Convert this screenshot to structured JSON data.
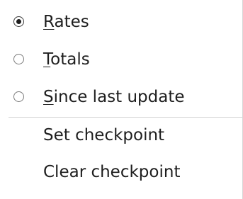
{
  "menu": {
    "radio_items": [
      {
        "mnemonic": "R",
        "rest": "ates",
        "selected": true
      },
      {
        "mnemonic": "T",
        "rest": "otals",
        "selected": false
      },
      {
        "mnemonic": "S",
        "rest": "ince last update",
        "selected": false
      }
    ],
    "actions": [
      {
        "label": "Set checkpoint"
      },
      {
        "label": "Clear checkpoint"
      }
    ]
  }
}
